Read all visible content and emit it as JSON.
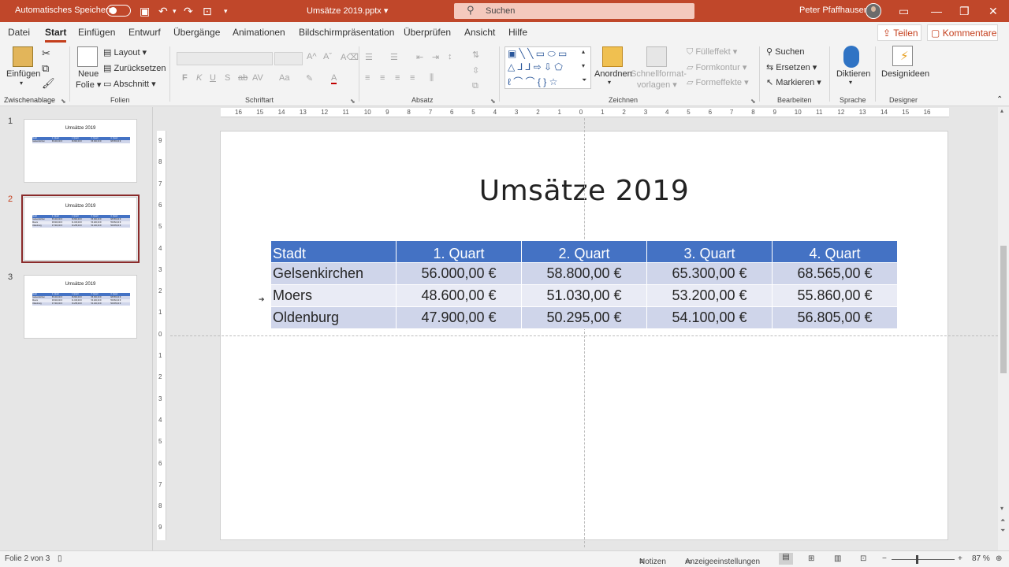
{
  "titlebar": {
    "autosave_label": "Automatisches Speichern",
    "document_title": "Umsätze 2019.pptx",
    "search_placeholder": "Suchen",
    "user_name": "Peter Pfaffhausen"
  },
  "tabs": [
    "Datei",
    "Start",
    "Einfügen",
    "Entwurf",
    "Übergänge",
    "Animationen",
    "Bildschirmpräsentation",
    "Überprüfen",
    "Ansicht",
    "Hilfe"
  ],
  "active_tab": "Start",
  "share_label": "Teilen",
  "comment_label": "Kommentare",
  "ribbon": {
    "clipboard": {
      "paste": "Einfügen",
      "group": "Zwischenablage"
    },
    "slides": {
      "new_slide_1": "Neue",
      "new_slide_2": "Folie",
      "layout": "Layout",
      "reset": "Zurücksetzen",
      "section": "Abschnitt",
      "group": "Folien"
    },
    "font": {
      "group": "Schriftart",
      "bold": "F",
      "italic": "K",
      "underline": "U",
      "strike": "S",
      "spacing": "AV"
    },
    "paragraph": {
      "group": "Absatz"
    },
    "drawing": {
      "arrange_1": "Anordnen",
      "quick_styles_1": "Schnellformat-",
      "quick_styles_2": "vorlagen",
      "fill": "Fülleffekt",
      "outline": "Formkontur",
      "effects": "Formeffekte",
      "group": "Zeichnen"
    },
    "editing": {
      "find": "Suchen",
      "replace": "Ersetzen",
      "select": "Markieren",
      "group": "Bearbeiten"
    },
    "voice": {
      "dictate": "Diktieren",
      "group": "Sprache"
    },
    "designer": {
      "ideas": "Designideen",
      "group": "Designer"
    }
  },
  "thumbnails": [
    {
      "number": "1",
      "title": "Umsätze 2019",
      "selected": false,
      "rows": [
        [
          "Stadt",
          "1. Quart",
          "2. Quart",
          "3. Quart",
          "4. Quart"
        ],
        [
          "Gelsenkirchen",
          "56.000,00 €",
          "58.800,00 €",
          "65.300,00 €",
          "68.565,00 €"
        ]
      ]
    },
    {
      "number": "2",
      "title": "Umsätze 2019",
      "selected": true,
      "rows": [
        [
          "Stadt",
          "1. Quart",
          "2. Quart",
          "3. Quart",
          "4. Quart"
        ],
        [
          "Gelsenkirchen",
          "56.000,00 €",
          "58.800,00 €",
          "65.300,00 €",
          "68.565,00 €"
        ],
        [
          "Moers",
          "48.600,00 €",
          "51.030,00 €",
          "53.200,00 €",
          "55.860,00 €"
        ],
        [
          "Oldenburg",
          "47.900,00 €",
          "50.295,00 €",
          "54.100,00 €",
          "56.805,00 €"
        ]
      ]
    },
    {
      "number": "3",
      "title": "Umsätze 2019",
      "selected": false,
      "rows": [
        [
          "Stadt",
          "1. Quart",
          "2. Quart",
          "3. Quart",
          "4. Quart"
        ],
        [
          "Gelsenkirchen",
          "56.000,00 €",
          "58.800,00 €",
          "65.300,00 €",
          "68.565,00 €"
        ],
        [
          "Moers",
          "48.600,00 €",
          "51.030,00 €",
          "53.200,00 €",
          "55.860,00 €"
        ],
        [
          "Oldenburg",
          "47.900,00 €",
          "50.295,00 €",
          "54.100,00 €",
          "56.805,00 €"
        ]
      ]
    }
  ],
  "ruler": {
    "horizontal": [
      "16",
      "15",
      "14",
      "13",
      "12",
      "11",
      "10",
      "9",
      "8",
      "7",
      "6",
      "5",
      "4",
      "3",
      "2",
      "1",
      "0",
      "1",
      "2",
      "3",
      "4",
      "5",
      "6",
      "7",
      "8",
      "9",
      "10",
      "11",
      "12",
      "13",
      "14",
      "15",
      "16"
    ],
    "vertical": [
      "9",
      "8",
      "7",
      "6",
      "5",
      "4",
      "3",
      "2",
      "1",
      "0",
      "1",
      "2",
      "3",
      "4",
      "5",
      "6",
      "7",
      "8",
      "9"
    ]
  },
  "slide": {
    "title": "Umsätze 2019",
    "table": {
      "headers": [
        "Stadt",
        "1. Quart",
        "2. Quart",
        "3. Quart",
        "4. Quart"
      ],
      "rows": [
        [
          "Gelsenkirchen",
          "56.000,00 €",
          "58.800,00 €",
          "65.300,00 €",
          "68.565,00 €"
        ],
        [
          "Moers",
          "48.600,00 €",
          "51.030,00 €",
          "53.200,00 €",
          "55.860,00 €"
        ],
        [
          "Oldenburg",
          "47.900,00 €",
          "50.295,00 €",
          "54.100,00 €",
          "56.805,00 €"
        ]
      ]
    }
  },
  "statusbar": {
    "slide_info": "Folie 2 von 3",
    "notes": "Notizen",
    "display_settings": "Anzeigeeinstellungen",
    "zoom": "87 %"
  },
  "colors": {
    "accent": "#c43e1c",
    "titlebar": "#c0472a",
    "table_header": "#4472c4",
    "table_row_odd": "#cfd5ea",
    "table_row_even": "#e9ebf5"
  }
}
